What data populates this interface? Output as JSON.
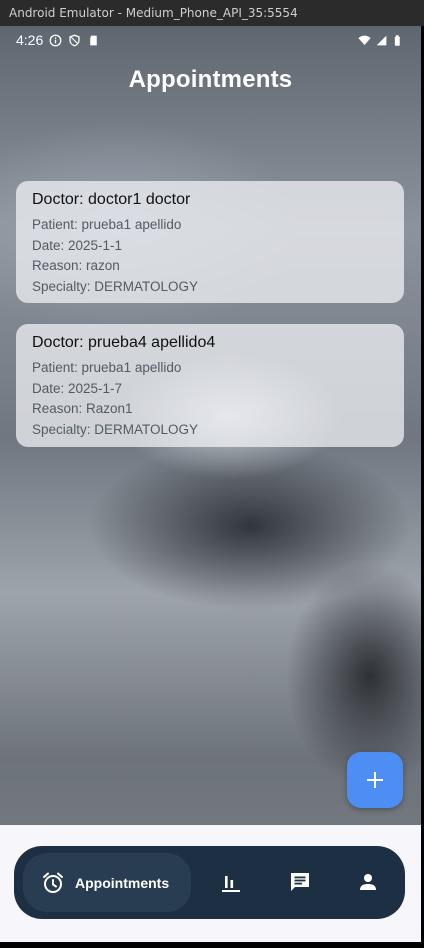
{
  "window": {
    "title": "Android Emulator - Medium_Phone_API_35:5554"
  },
  "status_bar": {
    "time": "4:26"
  },
  "header": {
    "title": "Appointments"
  },
  "appointments": [
    {
      "doctor": "Doctor: doctor1 doctor",
      "patient": "Patient: prueba1 apellido",
      "date": "Date: 2025-1-1",
      "reason": "Reason: razon",
      "specialty": "Specialty: DERMATOLOGY"
    },
    {
      "doctor": "Doctor: prueba4 apellido4",
      "patient": "Patient: prueba1 apellido",
      "date": "Date: 2025-1-7",
      "reason": "Reason: Razon1",
      "specialty": "Specialty: DERMATOLOGY"
    }
  ],
  "fab": {
    "icon": "plus-icon",
    "color": "#4d8ef5"
  },
  "bottom_nav": {
    "items": [
      {
        "label": "Appointments",
        "icon": "alarm-clock-icon",
        "active": true
      },
      {
        "label": "",
        "icon": "bar-chart-icon",
        "active": false
      },
      {
        "label": "",
        "icon": "chat-icon",
        "active": false
      },
      {
        "label": "",
        "icon": "person-icon",
        "active": false
      }
    ],
    "background": "#1d3043"
  }
}
